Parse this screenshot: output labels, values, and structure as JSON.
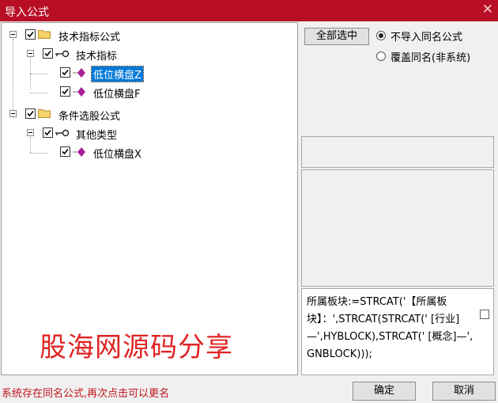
{
  "window": {
    "title": "导入公式",
    "close_glyph": "✕"
  },
  "tree": {
    "items": [
      {
        "label": "技术指标公式",
        "checked": true,
        "type": "folder"
      },
      {
        "label": "技术指标",
        "checked": true,
        "type": "key"
      },
      {
        "label": "低位横盘Z",
        "checked": true,
        "type": "formula",
        "selected": true
      },
      {
        "label": "低位横盘F",
        "checked": true,
        "type": "formula"
      },
      {
        "label": "条件选股公式",
        "checked": true,
        "type": "folder"
      },
      {
        "label": "其他类型",
        "checked": true,
        "type": "key"
      },
      {
        "label": "低位横盘X",
        "checked": true,
        "type": "formula"
      }
    ]
  },
  "watermark": "股海网源码分享",
  "options": {
    "select_all_label": "全部选中",
    "radio_skip_label": "不导入同名公式",
    "radio_overwrite_label": "覆盖同名(非系统)",
    "selected": "skip"
  },
  "formula_text": "所属板块:=STRCAT('【所属板块】：',STRCAT(STRCAT(' [行业]—',HYBLOCK),STRCAT(' [概念]—',GNBLOCK)));",
  "status_text": "系统存在同名公式,再次点击可以更名",
  "buttons": {
    "ok": "确定",
    "cancel": "取消"
  },
  "colors": {
    "titlebar": "#b90f25",
    "selection": "#0078d7",
    "watermark": "#e02424",
    "status": "#c0141c"
  }
}
